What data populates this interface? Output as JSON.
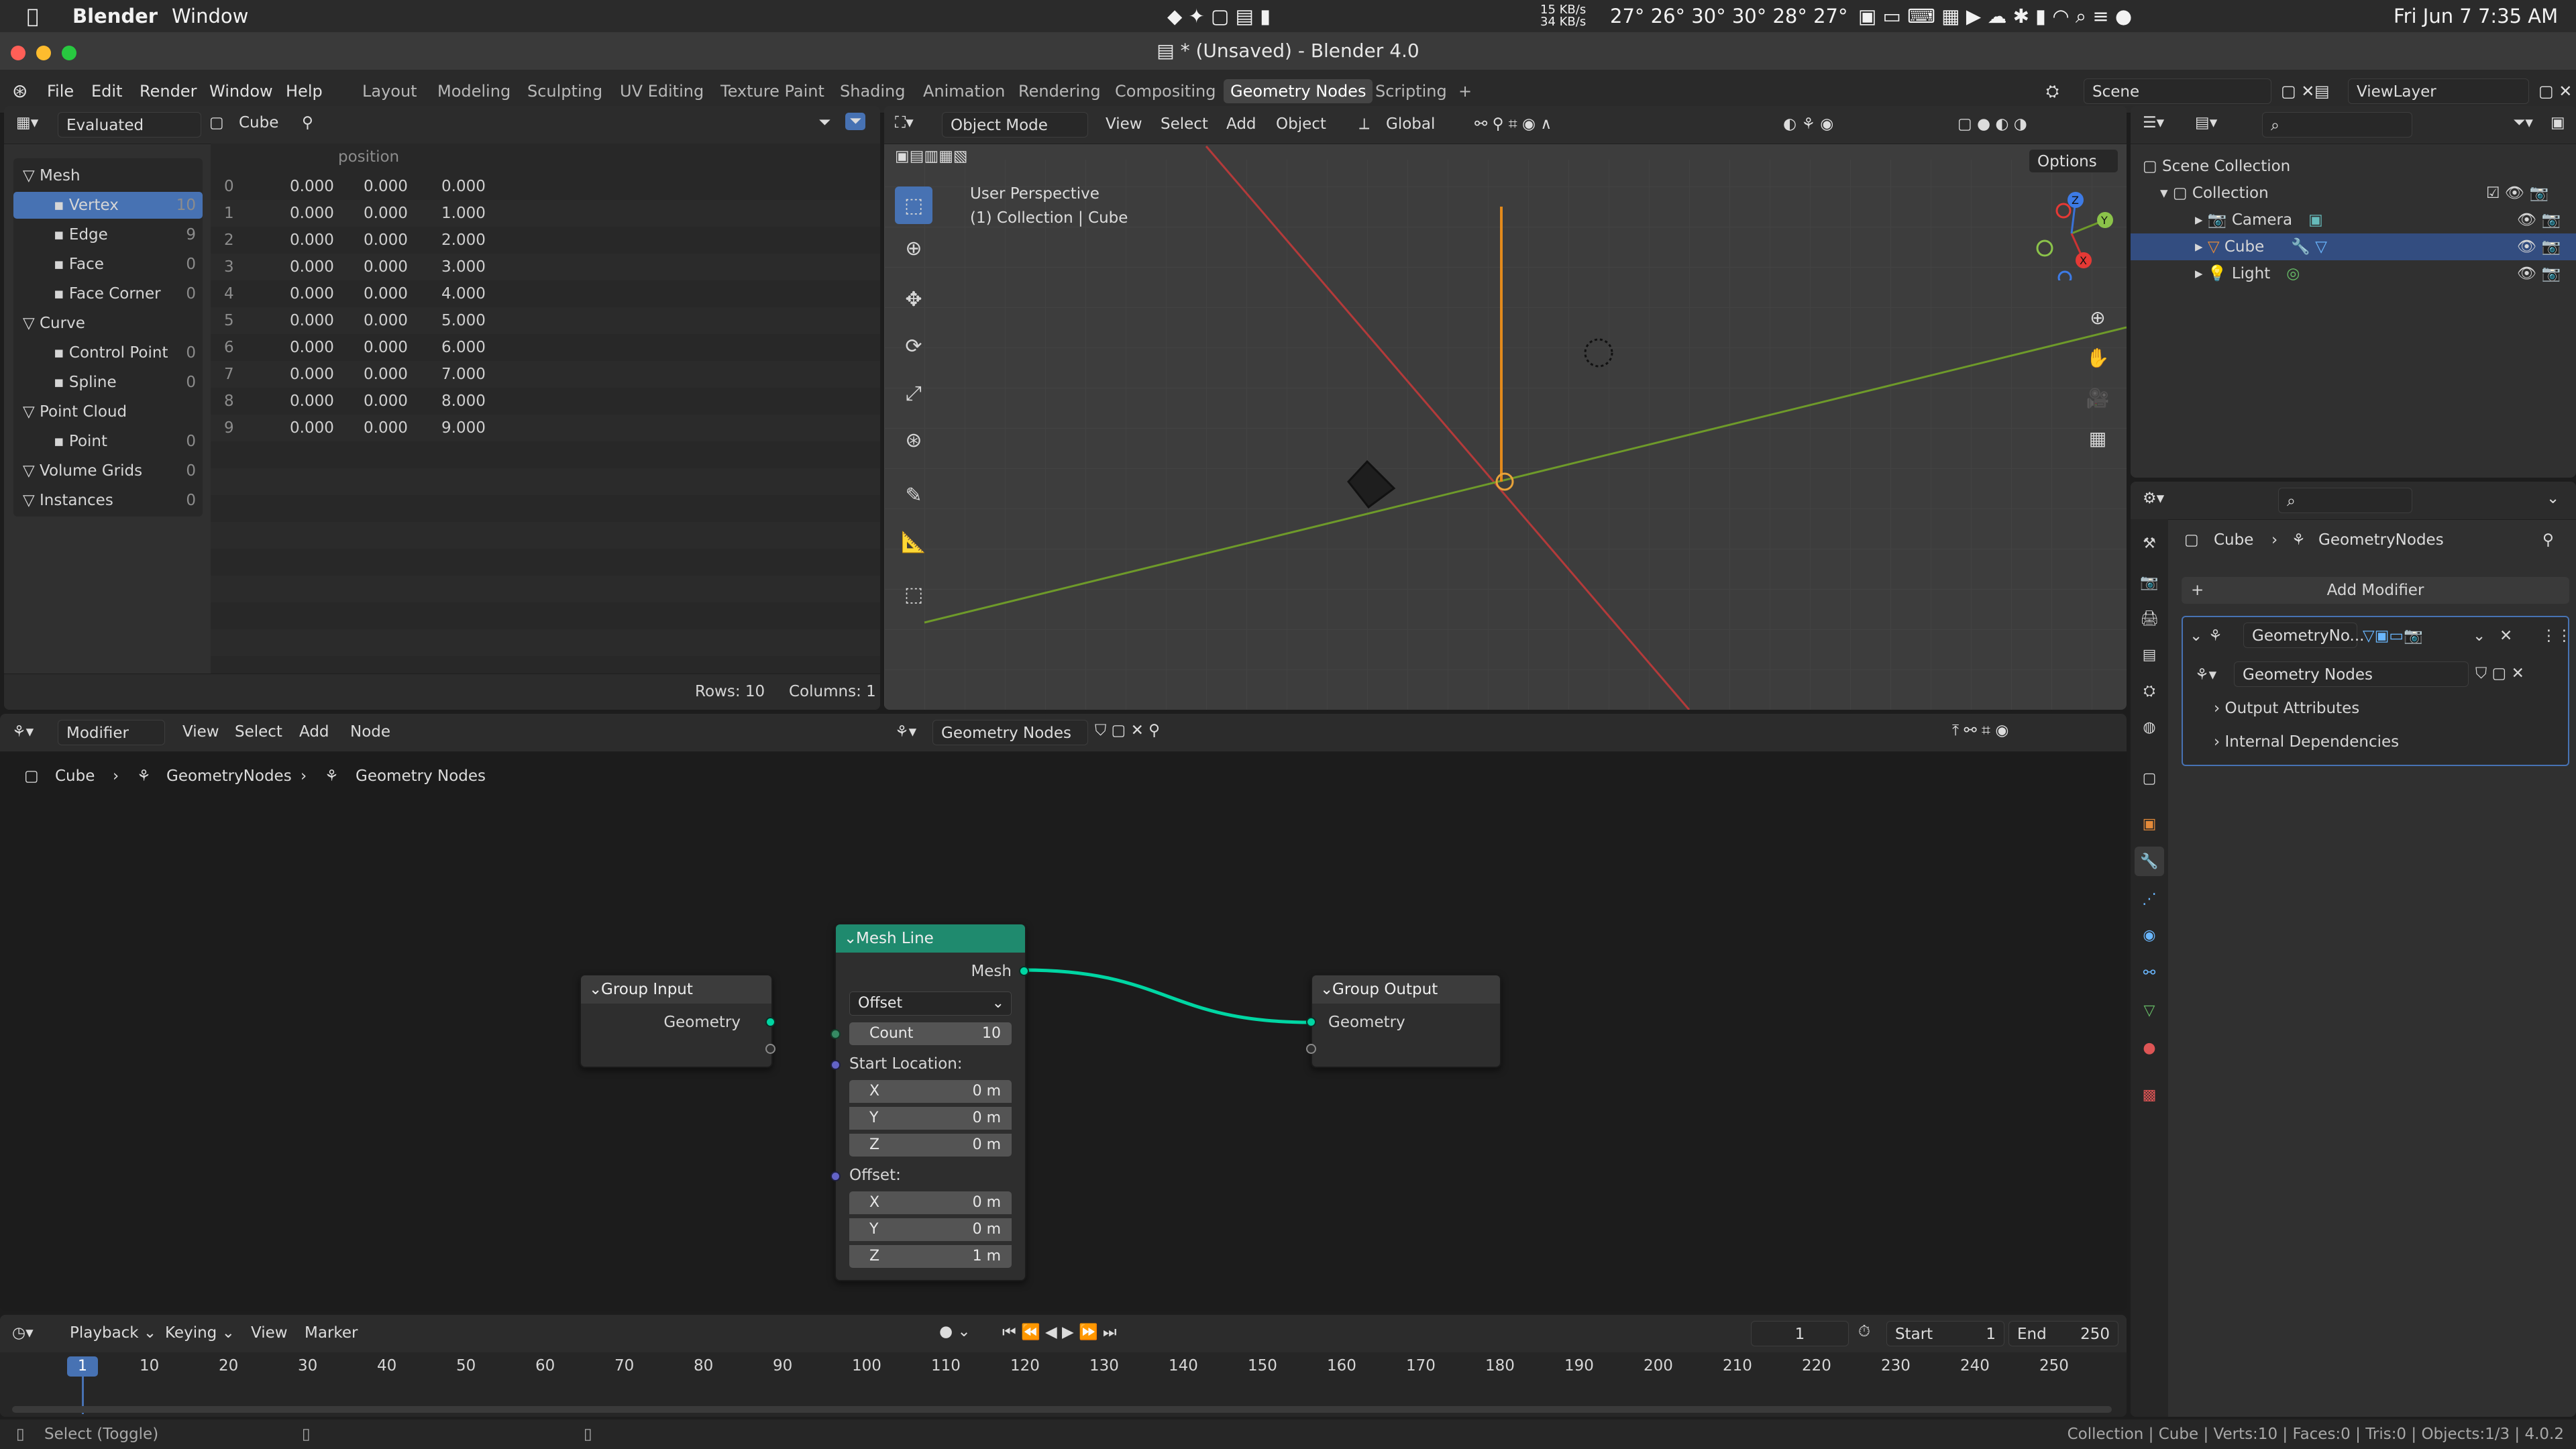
{
  "macbar": {
    "app": "Blender",
    "menu_window": "Window",
    "net_up": "15 KB/s",
    "net_down": "34 KB/s",
    "temps": "27° 26° 30° 30° 28° 27°",
    "datetime": "Fri Jun 7  7:35 AM"
  },
  "window": {
    "title": "* (Unsaved) - Blender 4.0"
  },
  "topmenu": {
    "items": [
      "File",
      "Edit",
      "Render",
      "Window",
      "Help"
    ],
    "workspaces": [
      "Layout",
      "Modeling",
      "Sculpting",
      "UV Editing",
      "Texture Paint",
      "Shading",
      "Animation",
      "Rendering",
      "Compositing",
      "Geometry Nodes",
      "Scripting"
    ],
    "active_workspace": "Geometry Nodes",
    "scene": "Scene",
    "view_layer": "ViewLayer"
  },
  "spreadsheet": {
    "mode": "Evaluated",
    "object": "Cube",
    "column": "position",
    "domains": [
      {
        "label": "Mesh",
        "count": "",
        "indent": 0
      },
      {
        "label": "Vertex",
        "count": "10",
        "indent": 1,
        "active": true
      },
      {
        "label": "Edge",
        "count": "9",
        "indent": 1
      },
      {
        "label": "Face",
        "count": "0",
        "indent": 1
      },
      {
        "label": "Face Corner",
        "count": "0",
        "indent": 1
      },
      {
        "label": "Curve",
        "count": "",
        "indent": 0
      },
      {
        "label": "Control Point",
        "count": "0",
        "indent": 1
      },
      {
        "label": "Spline",
        "count": "0",
        "indent": 1
      },
      {
        "label": "Point Cloud",
        "count": "",
        "indent": 0
      },
      {
        "label": "Point",
        "count": "0",
        "indent": 1
      },
      {
        "label": "Volume Grids",
        "count": "0",
        "indent": 0
      },
      {
        "label": "Instances",
        "count": "0",
        "indent": 0
      }
    ],
    "rows": [
      [
        "0",
        "0.000",
        "0.000",
        "0.000"
      ],
      [
        "1",
        "0.000",
        "0.000",
        "1.000"
      ],
      [
        "2",
        "0.000",
        "0.000",
        "2.000"
      ],
      [
        "3",
        "0.000",
        "0.000",
        "3.000"
      ],
      [
        "4",
        "0.000",
        "0.000",
        "4.000"
      ],
      [
        "5",
        "0.000",
        "0.000",
        "5.000"
      ],
      [
        "6",
        "0.000",
        "0.000",
        "6.000"
      ],
      [
        "7",
        "0.000",
        "0.000",
        "7.000"
      ],
      [
        "8",
        "0.000",
        "0.000",
        "8.000"
      ],
      [
        "9",
        "0.000",
        "0.000",
        "9.000"
      ]
    ],
    "rows_label": "Rows: 10",
    "columns_label": "Columns: 1"
  },
  "viewport": {
    "mode": "Object Mode",
    "menus": [
      "View",
      "Select",
      "Add",
      "Object"
    ],
    "orientation": "Global",
    "options": "Options",
    "overlay_title": "User Perspective",
    "overlay_sub": "(1) Collection | Cube"
  },
  "outliner": {
    "root": "Scene Collection",
    "collection": "Collection",
    "items": [
      {
        "label": "Camera",
        "selected": false
      },
      {
        "label": "Cube",
        "selected": true
      },
      {
        "label": "Light",
        "selected": false
      }
    ]
  },
  "props": {
    "breadcrumb_obj": "Cube",
    "breadcrumb_mod": "GeometryNodes",
    "add_modifier": "Add Modifier",
    "modifier_name": "GeometryNo...",
    "node_group": "Geometry Nodes",
    "sections": [
      "Output Attributes",
      "Internal Dependencies"
    ]
  },
  "nodeeditor": {
    "mode": "Modifier",
    "menus": [
      "View",
      "Select",
      "Add",
      "Node"
    ],
    "tree": "Geometry Nodes",
    "breadcrumb": [
      "Cube",
      "GeometryNodes",
      "Geometry Nodes"
    ],
    "group_input": {
      "title": "Group Input",
      "out": "Geometry"
    },
    "mesh_line": {
      "title": "Mesh Line",
      "out": "Mesh",
      "mode": "Offset",
      "count_label": "Count",
      "count": "10",
      "start_label": "Start Location:",
      "start": [
        [
          "X",
          "0 m"
        ],
        [
          "Y",
          "0 m"
        ],
        [
          "Z",
          "0 m"
        ]
      ],
      "offset_label": "Offset:",
      "offset": [
        [
          "X",
          "0 m"
        ],
        [
          "Y",
          "0 m"
        ],
        [
          "Z",
          "1 m"
        ]
      ]
    },
    "group_output": {
      "title": "Group Output",
      "in": "Geometry"
    }
  },
  "timeline": {
    "menus": [
      "Playback",
      "Keying",
      "View",
      "Marker"
    ],
    "current": "1",
    "start_label": "Start",
    "start": "1",
    "end_label": "End",
    "end": "250",
    "ticks": [
      "10",
      "20",
      "30",
      "40",
      "50",
      "60",
      "70",
      "80",
      "90",
      "100",
      "110",
      "120",
      "130",
      "140",
      "150",
      "160",
      "170",
      "180",
      "190",
      "200",
      "210",
      "220",
      "230",
      "240",
      "250"
    ]
  },
  "status": {
    "left": "Select (Toggle)",
    "right": "Collection | Cube | Verts:10 | Faces:0 | Tris:0 | Objects:1/3 | 4.0.2"
  }
}
